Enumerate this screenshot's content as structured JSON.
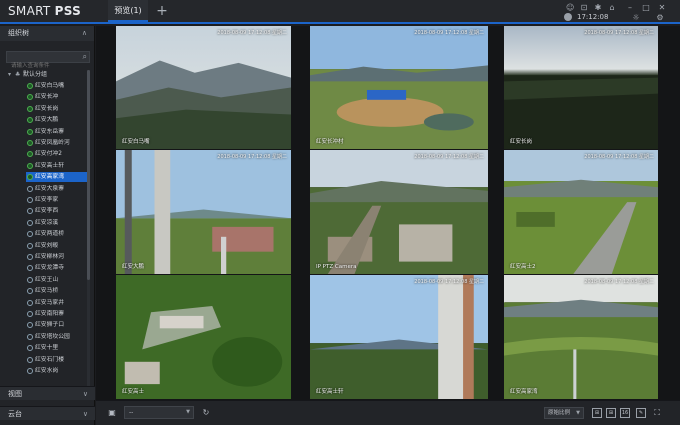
{
  "app": {
    "logo_regular": "SMART",
    "logo_bold": "PSS",
    "tab_preview": "预览(1)",
    "tab_add": "+",
    "clock": "17:12:08"
  },
  "sidebar": {
    "org_title": "组织树",
    "search_placeholder": "请输入查询条件",
    "root_label": "默认分组",
    "items": [
      {
        "label": "红安白马嘴",
        "online": true
      },
      {
        "label": "红安长冲",
        "online": true
      },
      {
        "label": "红安长岗",
        "online": true
      },
      {
        "label": "红安大鹏",
        "online": true
      },
      {
        "label": "红安东岳寨",
        "online": true
      },
      {
        "label": "红安凤凰岭河",
        "online": true
      },
      {
        "label": "红安付冲2",
        "online": true
      },
      {
        "label": "红安高士轩",
        "online": true
      },
      {
        "label": "红安高家湾",
        "online": true,
        "selected": true
      },
      {
        "label": "红安大泉寨",
        "online": false
      },
      {
        "label": "红安李家",
        "online": false
      },
      {
        "label": "红安李西",
        "online": false
      },
      {
        "label": "红安凉溪",
        "online": false
      },
      {
        "label": "红安两道桥",
        "online": false
      },
      {
        "label": "红安刘畈",
        "online": false
      },
      {
        "label": "红安柳林河",
        "online": false
      },
      {
        "label": "红安龙潭寺",
        "online": false
      },
      {
        "label": "红安王山",
        "online": false
      },
      {
        "label": "红安马桥",
        "online": false
      },
      {
        "label": "红安马家井",
        "online": false
      },
      {
        "label": "红安南阳寨",
        "online": false
      },
      {
        "label": "红安狮子口",
        "online": false
      },
      {
        "label": "红安塔坎公园",
        "online": false
      },
      {
        "label": "红安十里",
        "online": false
      },
      {
        "label": "红安石门楼",
        "online": false
      },
      {
        "label": "红安水岗",
        "online": false
      }
    ],
    "views_label": "视图",
    "ptz_label": "云台"
  },
  "grid": {
    "cells": [
      {
        "time": "2018-08-09 17:12:08 星期二",
        "name": "红安白马嘴",
        "scene": "mountains"
      },
      {
        "time": "2018-08-09 17:12:08 星期二",
        "name": "红安长冲村",
        "scene": "village"
      },
      {
        "time": "2018-08-09 17:12:08 星期二",
        "name": "红安长岗",
        "scene": "dusk"
      },
      {
        "time": "2018-08-09 17:12:08 星期二",
        "name": "红安大鹏",
        "scene": "tower"
      },
      {
        "time": "2018-08-09 17:12:08 星期二",
        "name": "IP PTZ Camera",
        "scene": "town"
      },
      {
        "time": "2018-08-09 17:12:08 星期二",
        "name": "红安高士2",
        "scene": "road"
      },
      {
        "time": "",
        "name": "红安高士",
        "scene": "aerial"
      },
      {
        "time": "2018-08-09 17:12:08 星期二",
        "name": "红安高士轩",
        "scene": "pole"
      },
      {
        "time": "2018-08-09 17:12:08 星期二",
        "name": "红安高家湾",
        "scene": "valley"
      }
    ]
  },
  "toolbar": {
    "select_value": "--",
    "ratio_value": "原始比例",
    "layout_16": "16"
  }
}
